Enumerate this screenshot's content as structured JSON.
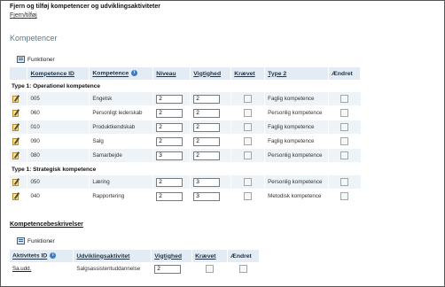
{
  "page": {
    "title": "Fjern og tilføj kompetencer og udviklingsaktiviteter",
    "remove_add_link": "Fjern/tilføj",
    "section_title": "Kompetencer",
    "functions_label": "Funktioner"
  },
  "competence_table": {
    "headers": {
      "id": "Kompetence ID",
      "name": "Kompetence",
      "level": "Niveau",
      "importance": "Vigtighed",
      "required": "Krævet",
      "type2": "Type 2",
      "changed": "Ændret"
    },
    "groups": [
      {
        "label": "Type 1: Operationel kompetence",
        "rows": [
          {
            "id": "005",
            "name": "Engelsk",
            "level": "2",
            "importance": "2",
            "type2": "Faglig kompetence"
          },
          {
            "id": "060",
            "name": "Personligt lederskab",
            "level": "2",
            "importance": "2",
            "type2": "Personlig kompetence"
          },
          {
            "id": "010",
            "name": "Produktkendskab",
            "level": "2",
            "importance": "2",
            "type2": "Faglig kompetence"
          },
          {
            "id": "090",
            "name": "Salg",
            "level": "2",
            "importance": "2",
            "type2": "Faglig kompetence"
          },
          {
            "id": "080",
            "name": "Samarbejde",
            "level": "3",
            "importance": "2",
            "type2": "Personlig kompetence"
          }
        ]
      },
      {
        "label": "Type 1: Strategisk kompetence",
        "rows": [
          {
            "id": "050",
            "name": "Læring",
            "level": "2",
            "importance": "3",
            "type2": "Personlig kompetence"
          },
          {
            "id": "040",
            "name": "Rapportering",
            "level": "2",
            "importance": "3",
            "type2": "Metodisk kompetence"
          }
        ]
      }
    ]
  },
  "description_section": {
    "title": "Kompetencebeskrivelser",
    "functions_label": "Funktioner"
  },
  "activity_table": {
    "headers": {
      "id": "Aktivitets ID",
      "activity": "Udviklingsaktivitet",
      "importance": "Vigtighed",
      "required": "Krævet",
      "changed": "Ændret"
    },
    "rows": [
      {
        "id": "Sa.udd.",
        "activity": "Salgsassistentuddannelse",
        "importance": "2"
      }
    ]
  }
}
